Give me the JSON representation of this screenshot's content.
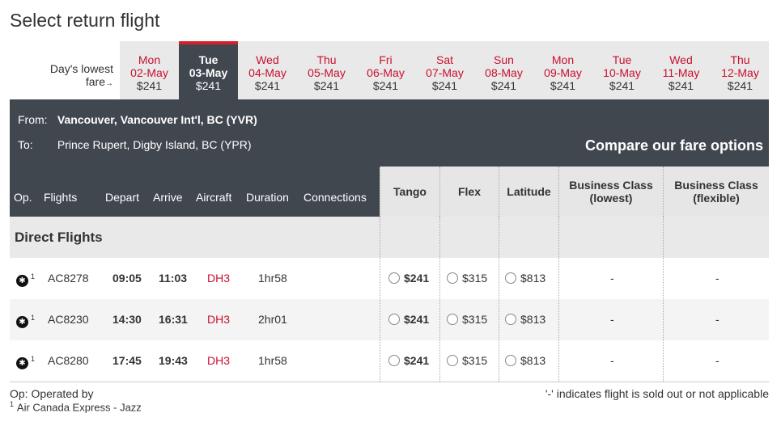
{
  "page": {
    "title": "Select return flight"
  },
  "day_selector": {
    "label_line1": "Day's lowest",
    "label_line2": "fare",
    "days": [
      {
        "dow": "Mon",
        "date": "02-May",
        "price": "$241",
        "selected": false
      },
      {
        "dow": "Tue",
        "date": "03-May",
        "price": "$241",
        "selected": true
      },
      {
        "dow": "Wed",
        "date": "04-May",
        "price": "$241",
        "selected": false
      },
      {
        "dow": "Thu",
        "date": "05-May",
        "price": "$241",
        "selected": false
      },
      {
        "dow": "Fri",
        "date": "06-May",
        "price": "$241",
        "selected": false
      },
      {
        "dow": "Sat",
        "date": "07-May",
        "price": "$241",
        "selected": false
      },
      {
        "dow": "Sun",
        "date": "08-May",
        "price": "$241",
        "selected": false
      },
      {
        "dow": "Mon",
        "date": "09-May",
        "price": "$241",
        "selected": false
      },
      {
        "dow": "Tue",
        "date": "10-May",
        "price": "$241",
        "selected": false
      },
      {
        "dow": "Wed",
        "date": "11-May",
        "price": "$241",
        "selected": false
      },
      {
        "dow": "Thu",
        "date": "12-May",
        "price": "$241",
        "selected": false
      }
    ]
  },
  "route": {
    "from_label": "From:",
    "from_value": "Vancouver, Vancouver Int'l, BC (YVR)",
    "to_label": "To:",
    "to_value": "Prince Rupert, Digby Island, BC (YPR)",
    "compare_label": "Compare our fare options"
  },
  "columns": {
    "op": "Op.",
    "flights": "Flights",
    "depart": "Depart",
    "arrive": "Arrive",
    "aircraft": "Aircraft",
    "duration": "Duration",
    "connections": "Connections",
    "tango": "Tango",
    "flex": "Flex",
    "latitude": "Latitude",
    "business_lowest_1": "Business Class",
    "business_lowest_2": "(lowest)",
    "business_flexible_1": "Business Class",
    "business_flexible_2": "(flexible)"
  },
  "section_label": "Direct Flights",
  "flights": [
    {
      "op_sup": "1",
      "flight": "AC8278",
      "depart": "09:05",
      "arrive": "11:03",
      "aircraft": "DH3",
      "duration": "1hr58",
      "tango": "$241",
      "flex": "$315",
      "latitude": "$813",
      "business_lowest": "-",
      "business_flexible": "-"
    },
    {
      "op_sup": "1",
      "flight": "AC8230",
      "depart": "14:30",
      "arrive": "16:31",
      "aircraft": "DH3",
      "duration": "2hr01",
      "tango": "$241",
      "flex": "$315",
      "latitude": "$813",
      "business_lowest": "-",
      "business_flexible": "-"
    },
    {
      "op_sup": "1",
      "flight": "AC8280",
      "depart": "17:45",
      "arrive": "19:43",
      "aircraft": "DH3",
      "duration": "1hr58",
      "tango": "$241",
      "flex": "$315",
      "latitude": "$813",
      "business_lowest": "-",
      "business_flexible": "-"
    }
  ],
  "footer": {
    "op_note": "Op: Operated by",
    "op_sup": "1",
    "operator": "Air Canada Express - Jazz",
    "sold_out_note": "'-' indicates flight is sold out or not applicable"
  },
  "colors": {
    "accent_red": "#c8102e",
    "header_dark": "#41474f",
    "selected_top": "#d71f2a"
  },
  "icons": {
    "airline_logo": "maple-leaf-icon",
    "fare_select": "radio-icon"
  }
}
